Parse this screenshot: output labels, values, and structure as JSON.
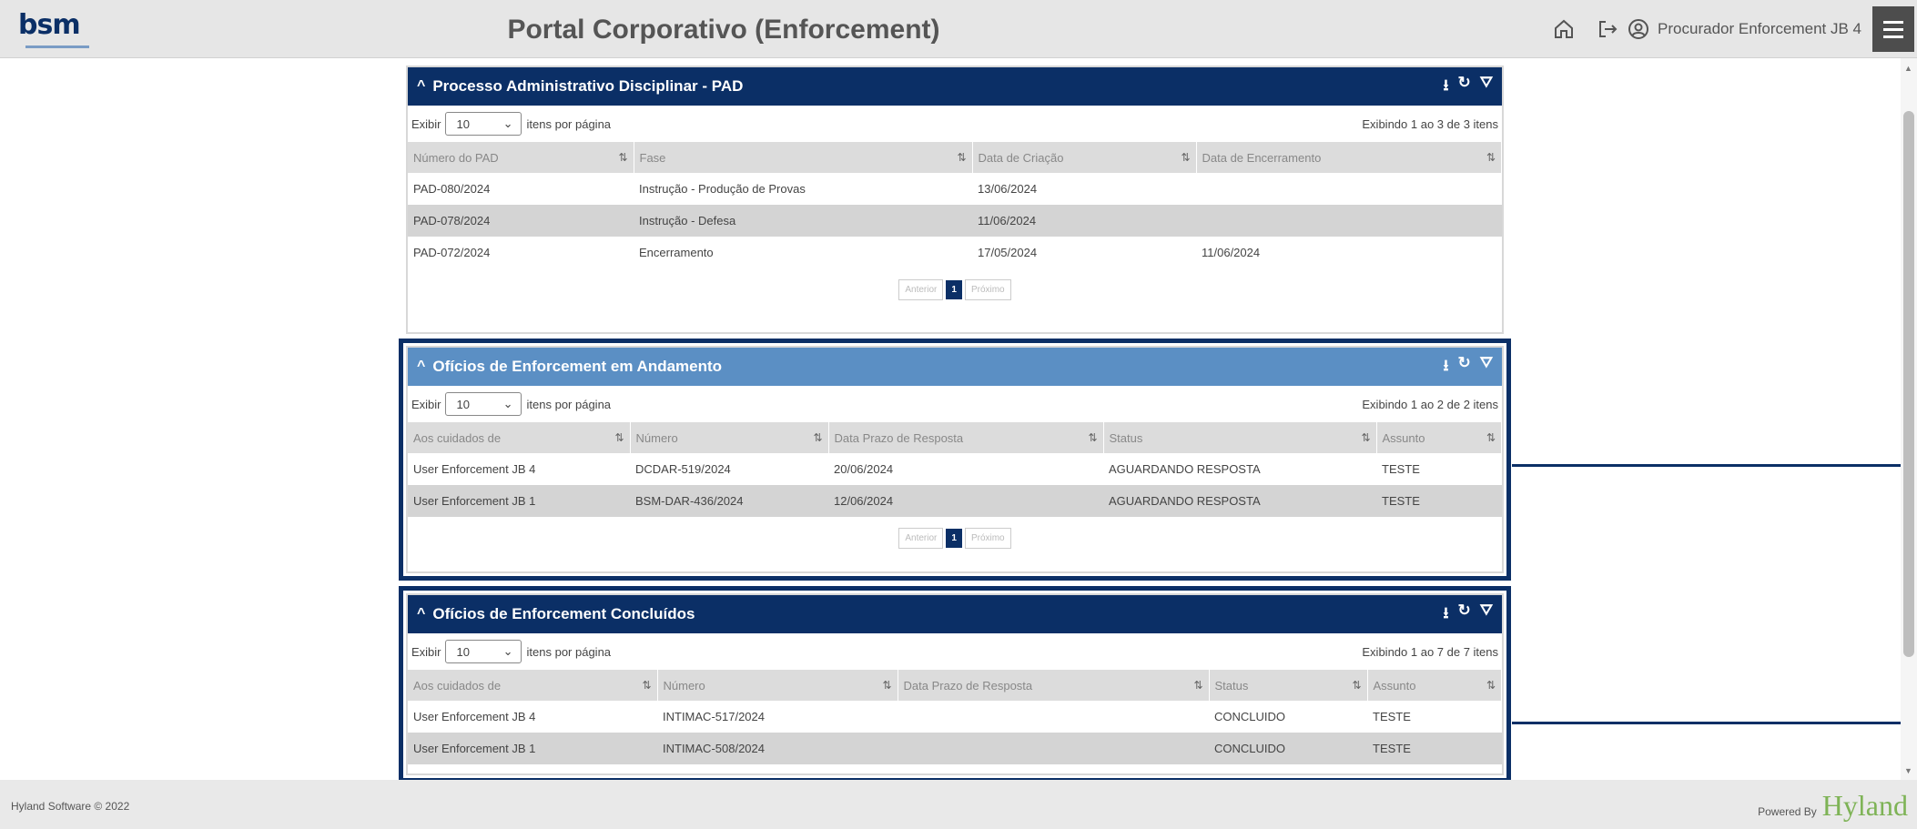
{
  "app": {
    "logo": "bsm",
    "title": "Portal Corporativo (Enforcement)",
    "user": "Procurador Enforcement JB 4"
  },
  "panels": [
    {
      "title": "Processo Administrativo Disciplinar - PAD",
      "show_label": "Exibir",
      "page_size": "10",
      "per_page_label": "itens por página",
      "info": "Exibindo 1 ao 3 de 3 itens",
      "columns": [
        "Número do PAD",
        "Fase",
        "Data de Criação",
        "Data de Encerramento"
      ],
      "rows": [
        [
          "PAD-080/2024",
          "Instrução - Produção de Provas",
          "13/06/2024",
          ""
        ],
        [
          "PAD-078/2024",
          "Instrução - Defesa",
          "11/06/2024",
          ""
        ],
        [
          "PAD-072/2024",
          "Encerramento",
          "17/05/2024",
          "11/06/2024"
        ]
      ],
      "pager": {
        "prev": "Anterior",
        "page": "1",
        "next": "Próximo"
      }
    },
    {
      "title": "Ofícios de Enforcement em Andamento",
      "show_label": "Exibir",
      "page_size": "10",
      "per_page_label": "itens por página",
      "info": "Exibindo 1 ao 2 de 2 itens",
      "columns": [
        "Aos cuidados de",
        "Número",
        "Data Prazo de Resposta",
        "Status",
        "Assunto"
      ],
      "rows": [
        [
          "User Enforcement JB 4",
          "DCDAR-519/2024",
          "20/06/2024",
          "AGUARDANDO RESPOSTA",
          "TESTE"
        ],
        [
          "User Enforcement JB 1",
          "BSM-DAR-436/2024",
          "12/06/2024",
          "AGUARDANDO RESPOSTA",
          "TESTE"
        ]
      ],
      "pager": {
        "prev": "Anterior",
        "page": "1",
        "next": "Próximo"
      }
    },
    {
      "title": "Ofícios de Enforcement Concluídos",
      "show_label": "Exibir",
      "page_size": "10",
      "per_page_label": "itens por página",
      "info": "Exibindo 1 ao 7 de 7 itens",
      "columns": [
        "Aos cuidados de",
        "Número",
        "Data Prazo de Resposta",
        "Status",
        "Assunto"
      ],
      "rows": [
        [
          "User Enforcement JB 4",
          "INTIMAC-517/2024",
          "",
          "CONCLUIDO",
          "TESTE"
        ],
        [
          "User Enforcement JB 1",
          "INTIMAC-508/2024",
          "",
          "CONCLUIDO",
          "TESTE"
        ]
      ]
    }
  ],
  "footer": {
    "copyright": "Hyland Software © 2022",
    "powered_by": "Powered By",
    "brand": "Hyland"
  },
  "colors": {
    "header_dark": "#0b2f66",
    "header_light": "#5b8fc4",
    "brand_green": "#7eb356"
  }
}
